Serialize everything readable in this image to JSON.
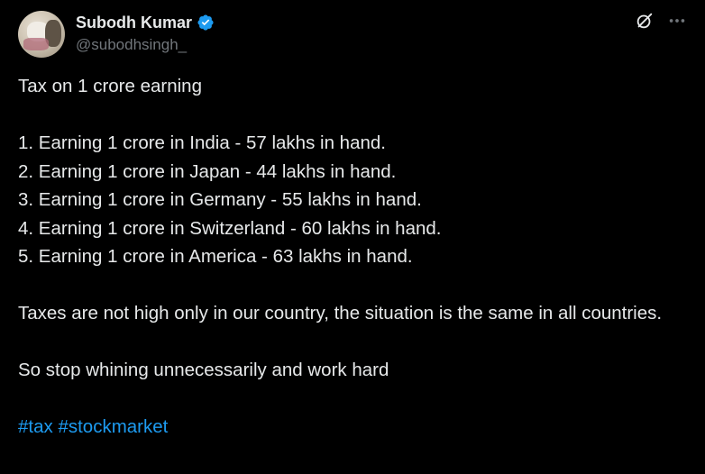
{
  "author": {
    "display_name": "Subodh Kumar",
    "handle": "@subodhsingh_",
    "verified": true
  },
  "tweet": {
    "heading": "Tax on 1 crore earning",
    "list": [
      "1. Earning 1 crore in India - 57 lakhs in hand.",
      "2. Earning 1 crore in Japan - 44 lakhs in hand.",
      "3. Earning 1 crore in Germany - 55 lakhs in hand.",
      "4. Earning 1 crore in Switzerland - 60 lakhs in hand.",
      "5. Earning 1 crore in America - 63 lakhs in hand."
    ],
    "paragraph": "Taxes are not high only in our country, the situation is the same in all countries.",
    "closing": "So stop whining unnecessarily and work hard",
    "hashtags": [
      "#tax",
      "#stockmarket"
    ]
  },
  "icons": {
    "verified": "verified-badge-icon",
    "grok": "grok-icon",
    "more": "more-options-icon"
  },
  "colors": {
    "background": "#000000",
    "text": "#e7e9ea",
    "secondary": "#71767b",
    "accent": "#1d9bf0"
  }
}
